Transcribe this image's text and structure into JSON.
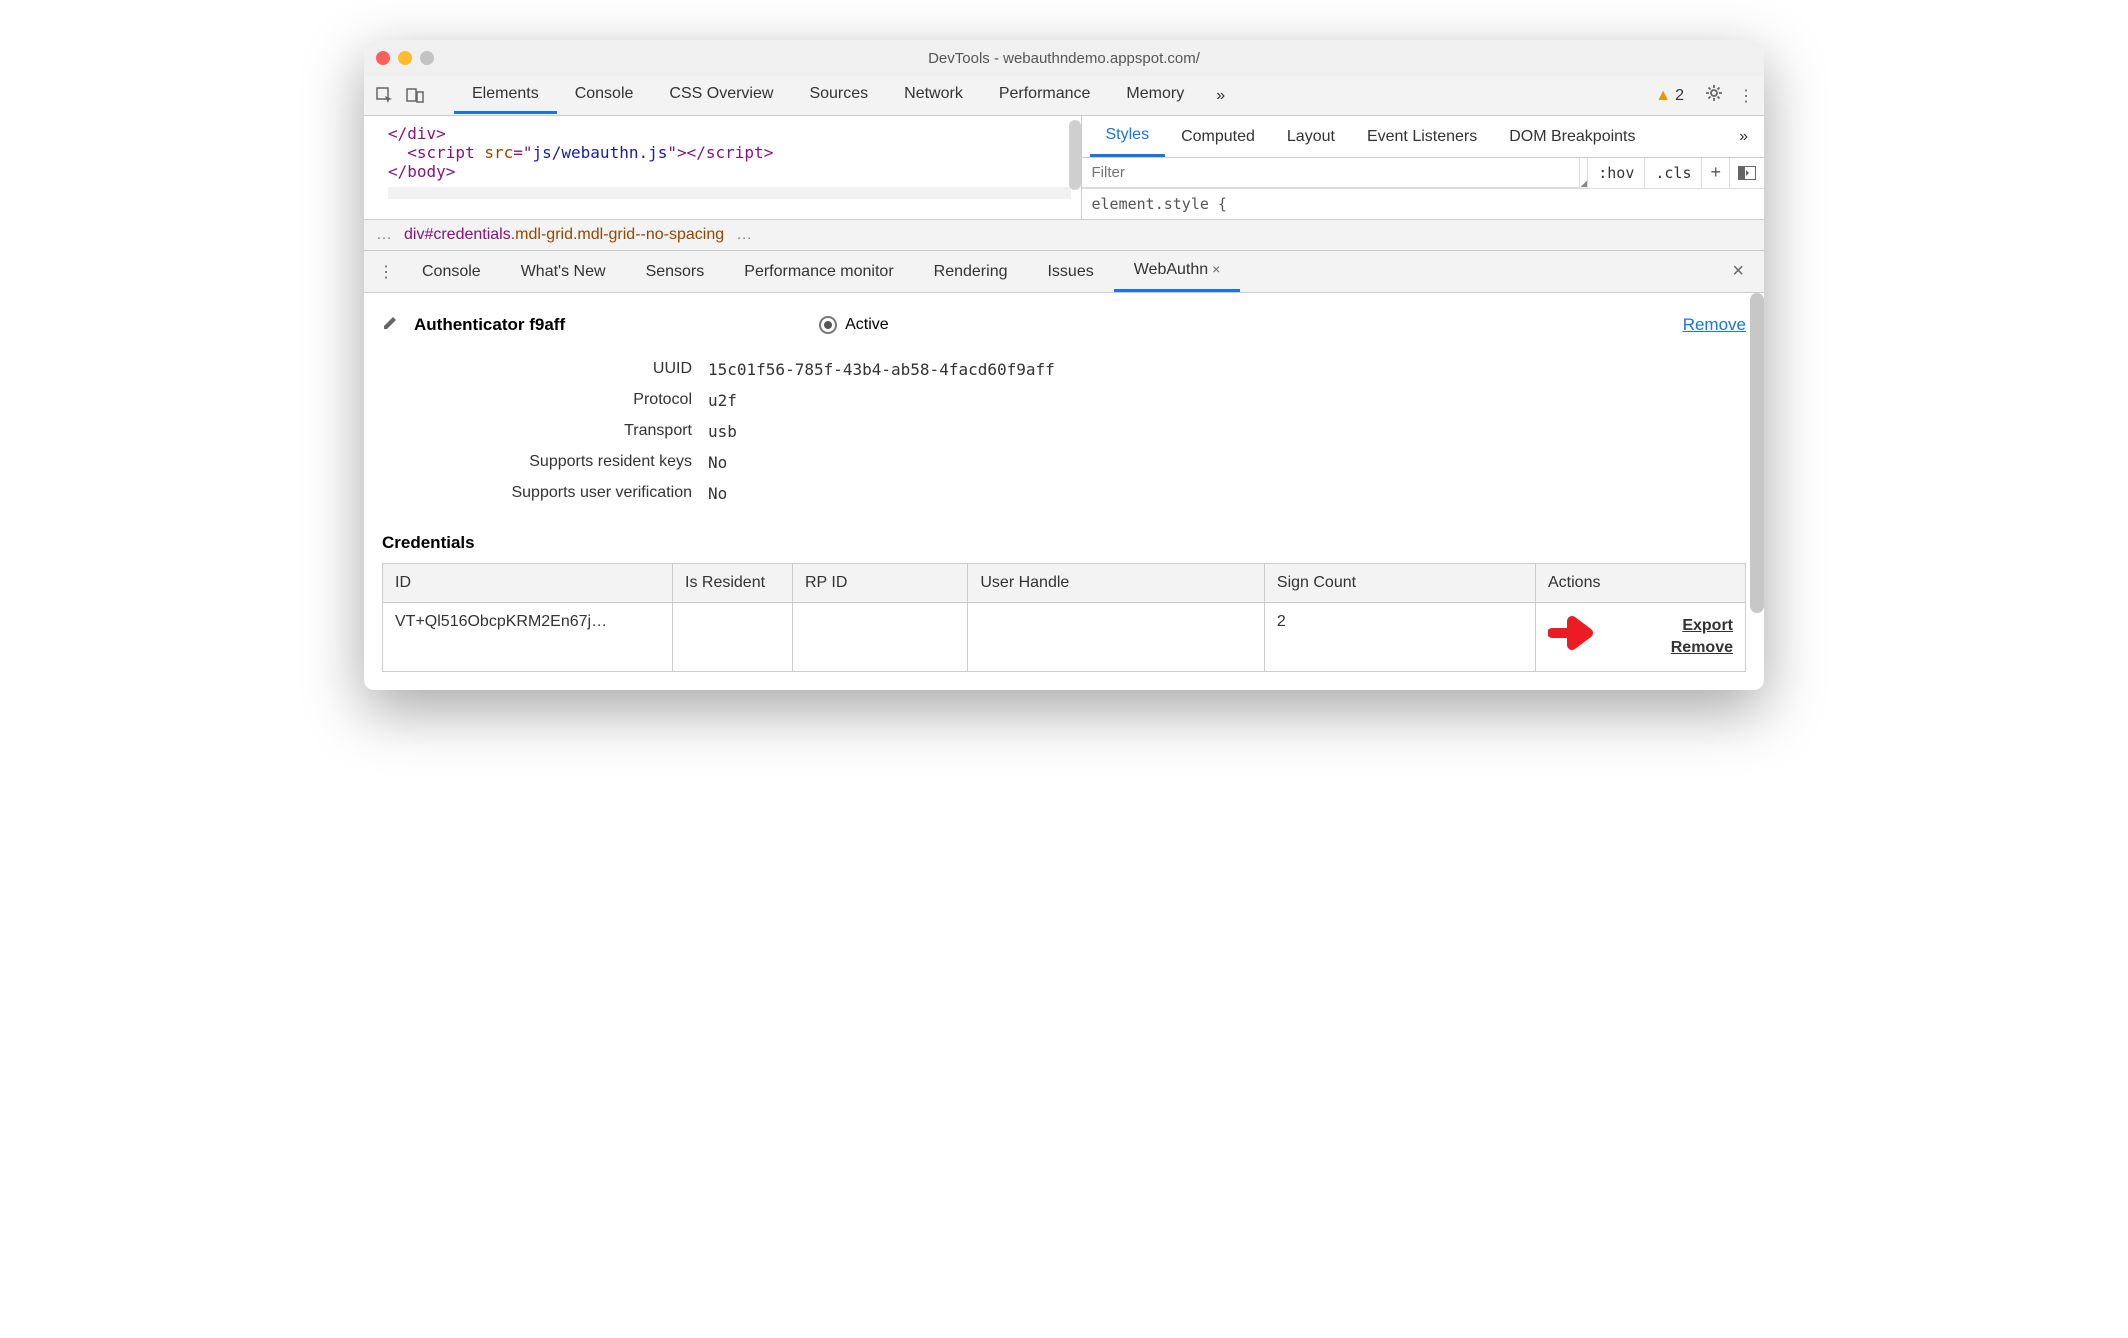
{
  "window": {
    "title": "DevTools - webauthndemo.appspot.com/"
  },
  "main_tabs": {
    "items": [
      "Elements",
      "Console",
      "CSS Overview",
      "Sources",
      "Network",
      "Performance",
      "Memory"
    ],
    "active_index": 0,
    "more_glyph": "»",
    "warning_count": "2"
  },
  "elements_source": {
    "l1": "</div>",
    "l2a": "<script ",
    "l2b": "src",
    "l2c": "=\"",
    "l2d": "js/webauthn.js",
    "l2e": "\"></",
    "l2f": "script",
    "l2g": ">",
    "l3": "</body>"
  },
  "breadcrumb": {
    "left_ell": "…",
    "tag": "div",
    "id": "#credentials",
    "classes": ".mdl-grid.mdl-grid--no-spacing",
    "right_ell": "…"
  },
  "styles_tabs": {
    "items": [
      "Styles",
      "Computed",
      "Layout",
      "Event Listeners",
      "DOM Breakpoints"
    ],
    "active_index": 0,
    "more": "»",
    "filter_placeholder": "Filter",
    "hov": ":hov",
    "cls": ".cls",
    "element_style": "element.style {"
  },
  "drawer_tabs": {
    "items": [
      "Console",
      "What's New",
      "Sensors",
      "Performance monitor",
      "Rendering",
      "Issues",
      "WebAuthn"
    ],
    "active_index": 6
  },
  "authenticator": {
    "name": "Authenticator f9aff",
    "active_label": "Active",
    "remove_label": "Remove",
    "props": {
      "uuid_label": "UUID",
      "uuid": "15c01f56-785f-43b4-ab58-4facd60f9aff",
      "protocol_label": "Protocol",
      "protocol": "u2f",
      "transport_label": "Transport",
      "transport": "usb",
      "resident_label": "Supports resident keys",
      "resident": "No",
      "uv_label": "Supports user verification",
      "uv": "No"
    }
  },
  "credentials": {
    "title": "Credentials",
    "headers": {
      "id": "ID",
      "resident": "Is Resident",
      "rp": "RP ID",
      "uh": "User Handle",
      "sc": "Sign Count",
      "actions": "Actions"
    },
    "row": {
      "id": "VT+Ql516ObcpKRM2En67j…",
      "resident": "",
      "rp": "",
      "uh": "",
      "sc": "2",
      "export": "Export",
      "remove": "Remove"
    }
  }
}
